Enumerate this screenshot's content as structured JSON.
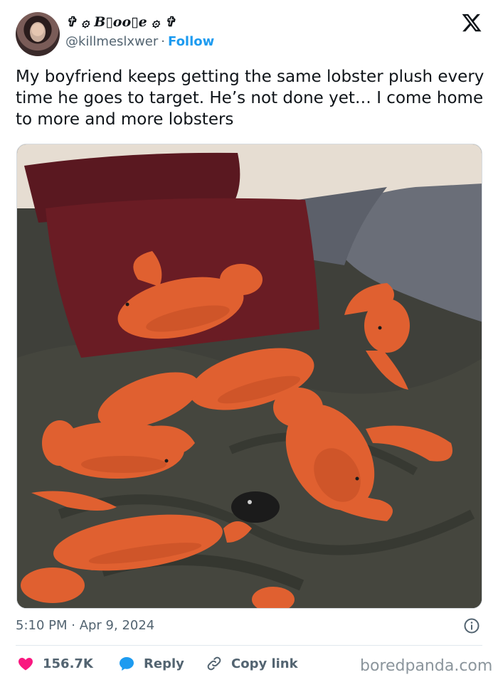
{
  "author": {
    "display_name": "✞ ۞ B▯oo▯e ۞ ✞",
    "handle": "@killmeslxwer",
    "separator": "·",
    "follow_label": "Follow"
  },
  "tweet": {
    "text": "My boyfriend keeps getting the same lobster plush every time he goes to target. He’s not done yet… I come home to more and more lobsters",
    "timestamp": "5:10 PM · Apr 9, 2024"
  },
  "actions": {
    "like_count": "156.7K",
    "reply_label": "Reply",
    "copy_link_label": "Copy link"
  },
  "watermark": "boredpanda.com",
  "colors": {
    "like_heart": "#f91880",
    "reply_bubble": "#1d9bf0",
    "link_accent": "#1d9bf0",
    "text_primary": "#0f1419",
    "text_secondary": "#536471"
  }
}
